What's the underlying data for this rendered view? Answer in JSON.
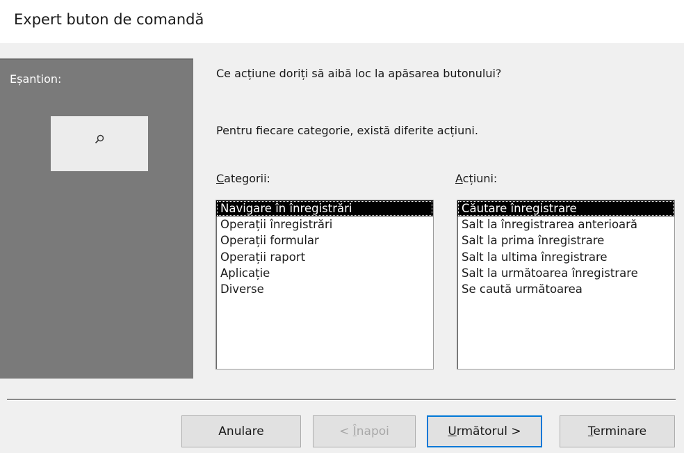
{
  "window": {
    "title": "Expert buton de comandă"
  },
  "sample": {
    "label": "Eșantion:",
    "button_icon": "search-icon"
  },
  "question": "Ce acțiune doriți să aibă loc la apăsarea butonului?",
  "info": "Pentru fiecare categorie, există diferite acțiuni.",
  "categories": {
    "label_accel": "C",
    "label_rest": "ategorii:",
    "items": [
      "Navigare în înregistrări",
      "Operații înregistrări",
      "Operații formular",
      "Operații raport",
      "Aplicație",
      "Diverse"
    ],
    "selected": "Navigare în înregistrări"
  },
  "actions": {
    "label_accel": "A",
    "label_rest": "cțiuni:",
    "items": [
      "Căutare înregistrare",
      "Salt la înregistrarea anterioară",
      "Salt la prima înregistrare",
      "Salt la ultima înregistrare",
      "Salt la următoarea înregistrare",
      "Se caută următoarea"
    ],
    "selected": "Căutare înregistrare"
  },
  "buttons": {
    "cancel": "Anulare",
    "back_prefix": "< ",
    "back_accel": "Î",
    "back_rest": "napoi",
    "next_accel": "U",
    "next_rest": "rmătorul >",
    "finish_accel": "T",
    "finish_rest": "erminare"
  },
  "colors": {
    "selection": "#000000",
    "sample_panel": "#7a7a7a",
    "dialog_bg": "#f0f0f0",
    "focus_border": "#0078d7"
  }
}
